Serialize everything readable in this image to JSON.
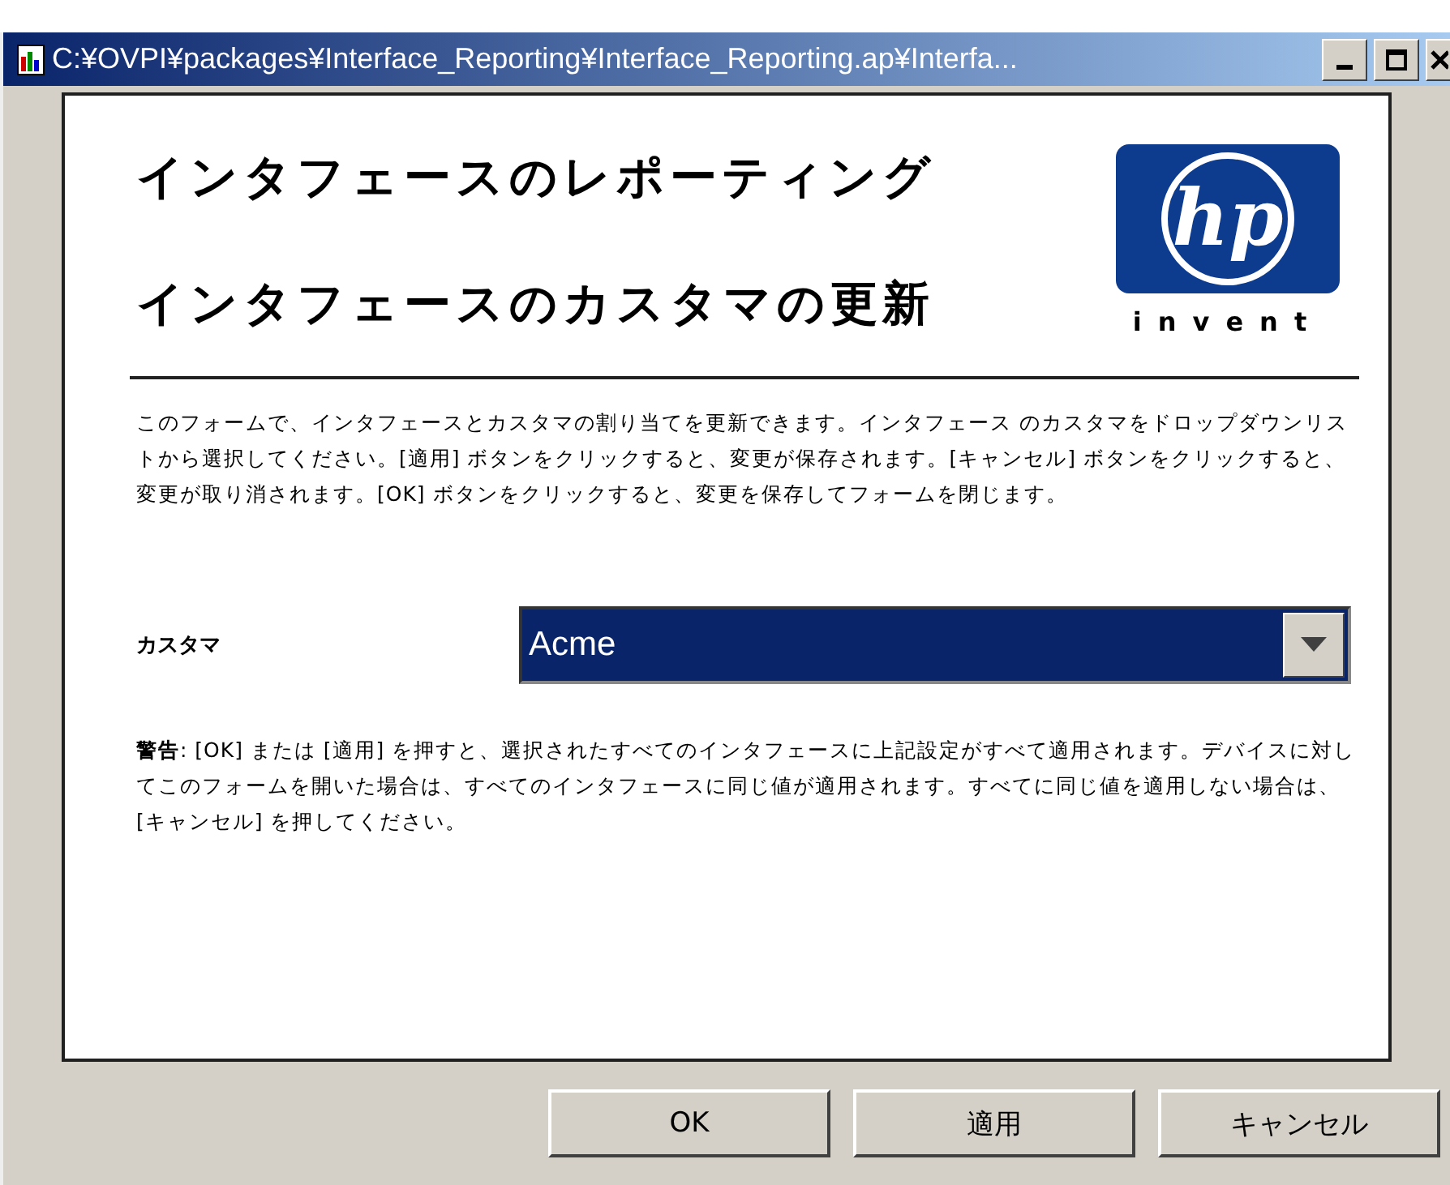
{
  "window": {
    "title": "C:¥OVPI¥packages¥Interface_Reporting¥Interface_Reporting.ap¥Interfa..."
  },
  "headings": [
    "インタフェースのレポーティング",
    "インタフェースのカスタマの更新"
  ],
  "logo": {
    "mark": "hp",
    "tagline": "invent"
  },
  "description": "このフォームで、インタフェースとカスタマの割り当てを更新できます。インタフェース のカスタマをドロップダウンリストから選択してください。[適用] ボタンをクリックすると、変更が保存されます。[キャンセル] ボタンをクリックすると、変更が取り消されます。[OK] ボタンをクリックすると、変更を保存してフォームを閉じます。",
  "customer_field": {
    "label": "カスタマ",
    "value": "Acme"
  },
  "warning": "**警告**: [OK] または [適用] を押すと、選択されたすべてのインタフェースに上記設定がすべて適用されます。デバイスに対してこのフォームを開いた場合は、すべてのインタフェースに同じ値が適用されます。すべてに同じ値を適用しない場合は、[キャンセル] を押してください。",
  "buttons": [
    "OK",
    "適用",
    "キャンセル"
  ]
}
